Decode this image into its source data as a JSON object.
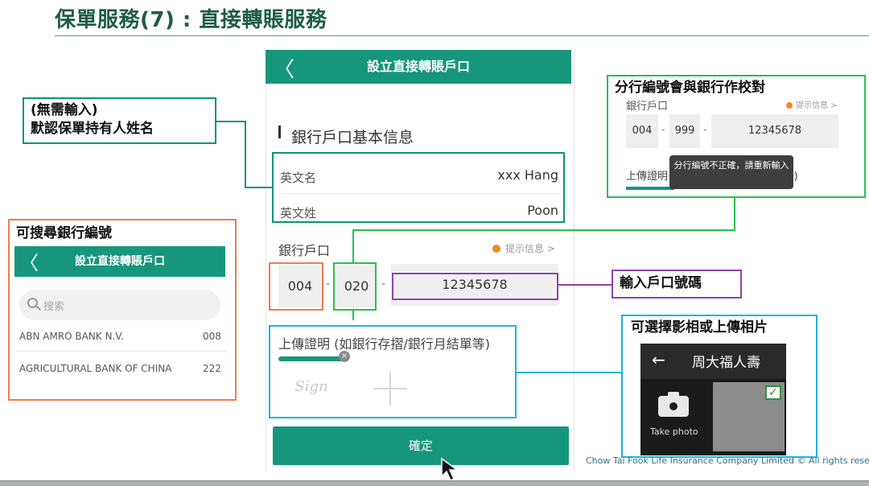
{
  "page_title": "保單服務(7) : 直接轉賬服務",
  "footer": {
    "copyright": "Chow Tai Fook Life Insurance Company Limited © All rights reserved"
  },
  "phone": {
    "back_glyph": "〈",
    "header_title": "設立直接轉賬戶口",
    "section_title": "銀行戶口基本信息",
    "english_first_name": {
      "label": "英文名",
      "value": "xxx Hang"
    },
    "english_last_name": {
      "label": "英文姓",
      "value": "Poon"
    },
    "bank_account_label": "銀行戶口",
    "hint_text": "提示信息 >",
    "bank_code": "004",
    "branch_code": "020",
    "account_number": "12345678",
    "separator": "-",
    "upload_label": "上傳證明 (如銀行存摺/銀行月結單等)",
    "upload_remove": "×",
    "signature_text": "Sign",
    "confirm_label": "確定"
  },
  "callouts": {
    "default_name": {
      "line1": "(無需輸入)",
      "line2": "默認保單持有人姓名"
    },
    "search_bank": "可搜尋銀行編號",
    "branch_check": "分行編號會與銀行作校對",
    "enter_account": "輸入戶口號碼",
    "photo_upload": "可選擇影相或上傳相片"
  },
  "search_panel": {
    "header_title": "設立直接轉賬戶口",
    "search_placeholder": "搜索",
    "banks": [
      {
        "name": "ABN AMRO BANK N.V.",
        "code": "008"
      },
      {
        "name": "AGRICULTURAL BANK OF CHINA",
        "code": "222"
      }
    ]
  },
  "branch_panel": {
    "label": "銀行戶口",
    "hint": "提示信息 >",
    "bank_code": "004",
    "branch_code": "999",
    "account_number": "12345678",
    "tooltip": "分行編號不正確，請重新輸入",
    "upload_label": "上傳證明 (如銀行存摺/銀行月結單等)"
  },
  "photo_panel": {
    "back_arrow": "←",
    "app_name": "周大福人壽",
    "take_photo": "Take photo",
    "check": "✓"
  },
  "colors": {
    "brand_teal": "#16967a",
    "title_green": "#1f5c47",
    "callout_orange": "#f07b4f",
    "callout_green": "#27c24c",
    "callout_purple": "#8e44ad",
    "callout_cyan": "#1fb3e0",
    "hint_orange": "#f28a1e"
  }
}
